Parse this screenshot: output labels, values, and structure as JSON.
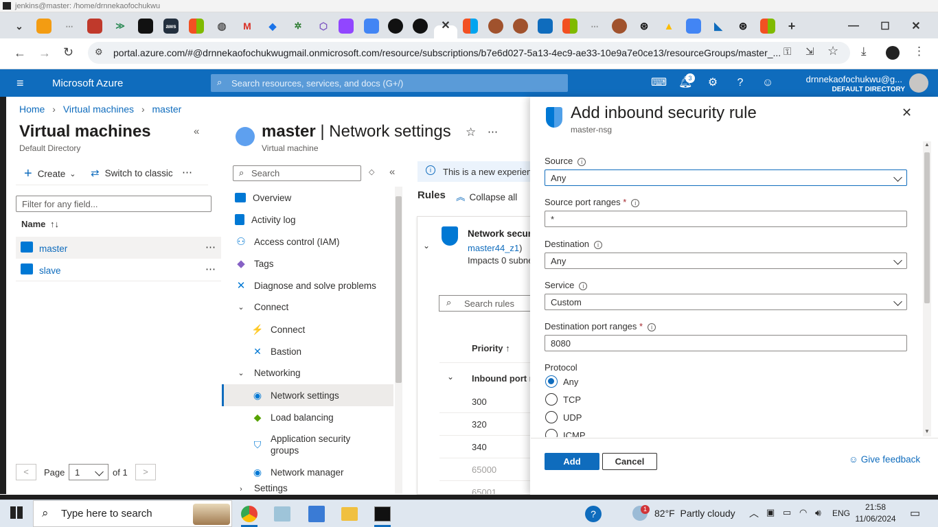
{
  "terminal": {
    "title": "jenkins@master: /home/drnnekaofochukwu"
  },
  "browser": {
    "url": "portal.azure.com/#@drnnekaofochukwugmail.onmicrosoft.com/resource/subscriptions/b7e6d027-5a13-4ec9-ae33-10e9a7e0ce13/resourceGroups/master_...",
    "new_tab_icon": "plus-icon"
  },
  "azure": {
    "brand": "Microsoft Azure",
    "search_placeholder": "Search resources, services, and docs (G+/)",
    "notifications_count": "3",
    "user_name": "drnnekaofochukwu@g...",
    "user_directory": "DEFAULT DIRECTORY"
  },
  "breadcrumb": [
    "Home",
    "Virtual machines",
    "master"
  ],
  "left": {
    "title": "Virtual machines",
    "subtitle": "Default Directory",
    "create": "Create",
    "switch": "Switch to classic",
    "filter_placeholder": "Filter for any field...",
    "col_name": "Name",
    "sort": "↑↓",
    "vms": [
      "master",
      "slave"
    ],
    "page_label": "Page",
    "page_value": "1",
    "of_label": "of 1"
  },
  "mid": {
    "title_main": "master",
    "title_sep": " | ",
    "title_sub": "Network settings",
    "subtitle": "Virtual machine",
    "search_placeholder": "Search",
    "menu": [
      "Overview",
      "Activity log",
      "Access control (IAM)",
      "Tags",
      "Diagnose and solve problems",
      "Connect",
      "Connect",
      "Bastion",
      "Networking",
      "Network settings",
      "Load balancing",
      "Application security groups",
      "Network manager",
      "Settings"
    ]
  },
  "content": {
    "banner": "This is a new experienc",
    "rules": "Rules",
    "collapse": "Collapse all",
    "nsg_title": "Network secur",
    "nsg_link": "master44_z1",
    "nsg_paren": ")",
    "impacts": "Impacts 0 subne",
    "search_rules": "Search rules",
    "priority": "Priority",
    "priority_arrow": "↑",
    "inbound": "Inbound port r",
    "priorities": [
      "300",
      "320",
      "340",
      "65000",
      "65001"
    ]
  },
  "panel": {
    "title": "Add inbound security rule",
    "subtitle": "master-nsg",
    "source_label": "Source",
    "source_value": "Any",
    "source_port_label": "Source port ranges",
    "source_port_value": "*",
    "dest_label": "Destination",
    "dest_value": "Any",
    "service_label": "Service",
    "service_value": "Custom",
    "dest_port_label": "Destination port ranges",
    "dest_port_value": "8080",
    "protocol_label": "Protocol",
    "protocols": [
      "Any",
      "TCP",
      "UDP",
      "ICMP"
    ],
    "required": "*",
    "add": "Add",
    "cancel": "Cancel",
    "feedback": "Give feedback"
  },
  "taskbar": {
    "search": "Type here to search",
    "weather": "82°F  Partly cloudy",
    "weather_badge": "1",
    "lang": "ENG",
    "time": "21:58",
    "date": "11/06/2024"
  }
}
